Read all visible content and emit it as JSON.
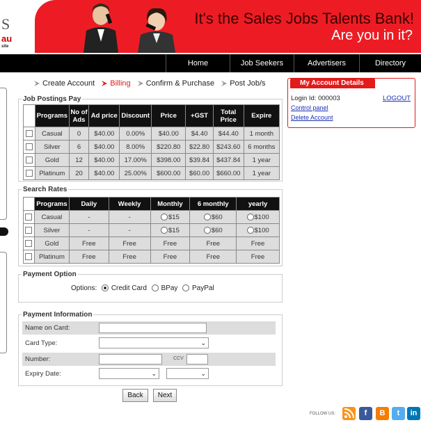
{
  "logo": {
    "l1": "S",
    "l2": "au",
    "l3": "site"
  },
  "banner": {
    "line1": "It's the Sales Jobs Talents Bank!",
    "line2": "Are you in it?"
  },
  "nav": [
    "Home",
    "Job Seekers",
    "Advertisers",
    "Directory"
  ],
  "steps": [
    "Create Account",
    "Billing",
    "Confirm & Purchase",
    "Post Job/s"
  ],
  "job_postings": {
    "legend": "Job Postings Pay",
    "headers": [
      "Programs",
      "No of Ads",
      "Ad price",
      "Discount",
      "Price",
      "+GST",
      "Total Price",
      "Expire"
    ],
    "rows": [
      [
        "Casual",
        "0",
        "$40.00",
        "0.00%",
        "$40.00",
        "$4.40",
        "$44.40",
        "1 month"
      ],
      [
        "Silver",
        "6",
        "$40.00",
        "8.00%",
        "$220.80",
        "$22.80",
        "$243.60",
        "6 months"
      ],
      [
        "Gold",
        "12",
        "$40.00",
        "17.00%",
        "$398.00",
        "$39.84",
        "$437.84",
        "1 year"
      ],
      [
        "Platinum",
        "20",
        "$40.00",
        "25.00%",
        "$600.00",
        "$60.00",
        "$660.00",
        "1 year"
      ]
    ]
  },
  "search_rates": {
    "legend": "Search Rates",
    "headers": [
      "Programs",
      "Daily",
      "Weekly",
      "Monthly",
      "6 monthly",
      "yearly"
    ],
    "rows": [
      [
        "Casual",
        "-",
        "-",
        "$15",
        "$60",
        "$100"
      ],
      [
        "Silver",
        "-",
        "-",
        "$15",
        "$60",
        "$100"
      ],
      [
        "Gold",
        "Free",
        "Free",
        "Free",
        "Free",
        "Free"
      ],
      [
        "Platinum",
        "Free",
        "Free",
        "Free",
        "Free",
        "Free"
      ]
    ]
  },
  "payment_option": {
    "legend": "Payment Option",
    "label": "Options:",
    "options": [
      "Credit Card",
      "BPay",
      "PayPal"
    ],
    "selected": "Credit Card"
  },
  "payment_info": {
    "legend": "Payment Information",
    "name_label": "Name on Card:",
    "card_type_label": "Card Type:",
    "number_label": "Number:",
    "ccv_label": "CCV",
    "expiry_label": "Expiry Date:"
  },
  "buttons": {
    "back": "Back",
    "next": "Next"
  },
  "account": {
    "title": "My Account Details",
    "login": "Login Id: 000003",
    "logout": "LOGOUT",
    "control_panel": "Control panel",
    "delete": "Delete Account"
  },
  "follow": "FOLLOW US:",
  "social": [
    "rss-icon",
    "facebook-icon",
    "blogger-icon",
    "twitter-icon",
    "linkedin-icon"
  ],
  "colors": {
    "brand_red": "#ed1c24",
    "nav_black": "#000000",
    "link_blue": "#1a2eb5"
  }
}
